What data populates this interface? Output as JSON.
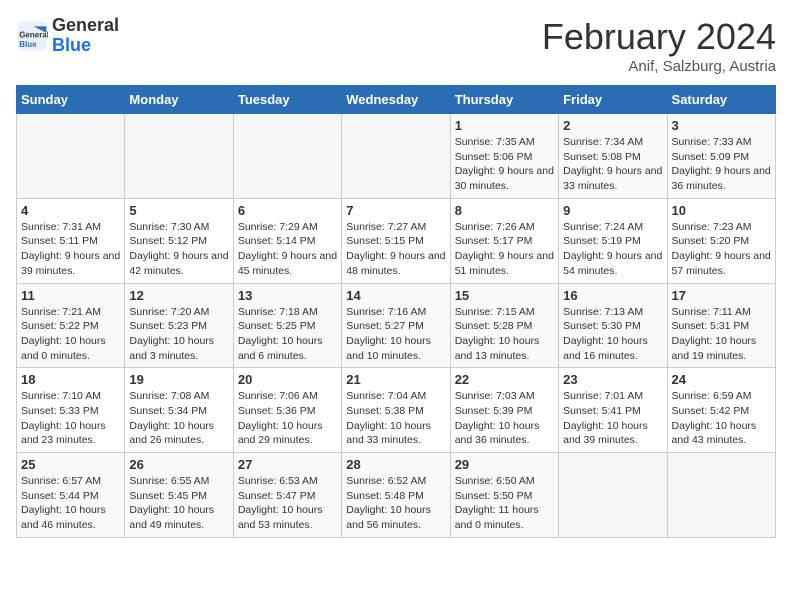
{
  "header": {
    "logo_line1": "General",
    "logo_line2": "Blue",
    "month": "February 2024",
    "location": "Anif, Salzburg, Austria"
  },
  "weekdays": [
    "Sunday",
    "Monday",
    "Tuesday",
    "Wednesday",
    "Thursday",
    "Friday",
    "Saturday"
  ],
  "weeks": [
    [
      null,
      null,
      null,
      null,
      {
        "day": "1",
        "sunrise": "7:35 AM",
        "sunset": "5:06 PM",
        "daylight": "9 hours and 30 minutes."
      },
      {
        "day": "2",
        "sunrise": "7:34 AM",
        "sunset": "5:08 PM",
        "daylight": "9 hours and 33 minutes."
      },
      {
        "day": "3",
        "sunrise": "7:33 AM",
        "sunset": "5:09 PM",
        "daylight": "9 hours and 36 minutes."
      }
    ],
    [
      {
        "day": "4",
        "sunrise": "7:31 AM",
        "sunset": "5:11 PM",
        "daylight": "9 hours and 39 minutes."
      },
      {
        "day": "5",
        "sunrise": "7:30 AM",
        "sunset": "5:12 PM",
        "daylight": "9 hours and 42 minutes."
      },
      {
        "day": "6",
        "sunrise": "7:29 AM",
        "sunset": "5:14 PM",
        "daylight": "9 hours and 45 minutes."
      },
      {
        "day": "7",
        "sunrise": "7:27 AM",
        "sunset": "5:15 PM",
        "daylight": "9 hours and 48 minutes."
      },
      {
        "day": "8",
        "sunrise": "7:26 AM",
        "sunset": "5:17 PM",
        "daylight": "9 hours and 51 minutes."
      },
      {
        "day": "9",
        "sunrise": "7:24 AM",
        "sunset": "5:19 PM",
        "daylight": "9 hours and 54 minutes."
      },
      {
        "day": "10",
        "sunrise": "7:23 AM",
        "sunset": "5:20 PM",
        "daylight": "9 hours and 57 minutes."
      }
    ],
    [
      {
        "day": "11",
        "sunrise": "7:21 AM",
        "sunset": "5:22 PM",
        "daylight": "10 hours and 0 minutes."
      },
      {
        "day": "12",
        "sunrise": "7:20 AM",
        "sunset": "5:23 PM",
        "daylight": "10 hours and 3 minutes."
      },
      {
        "day": "13",
        "sunrise": "7:18 AM",
        "sunset": "5:25 PM",
        "daylight": "10 hours and 6 minutes."
      },
      {
        "day": "14",
        "sunrise": "7:16 AM",
        "sunset": "5:27 PM",
        "daylight": "10 hours and 10 minutes."
      },
      {
        "day": "15",
        "sunrise": "7:15 AM",
        "sunset": "5:28 PM",
        "daylight": "10 hours and 13 minutes."
      },
      {
        "day": "16",
        "sunrise": "7:13 AM",
        "sunset": "5:30 PM",
        "daylight": "10 hours and 16 minutes."
      },
      {
        "day": "17",
        "sunrise": "7:11 AM",
        "sunset": "5:31 PM",
        "daylight": "10 hours and 19 minutes."
      }
    ],
    [
      {
        "day": "18",
        "sunrise": "7:10 AM",
        "sunset": "5:33 PM",
        "daylight": "10 hours and 23 minutes."
      },
      {
        "day": "19",
        "sunrise": "7:08 AM",
        "sunset": "5:34 PM",
        "daylight": "10 hours and 26 minutes."
      },
      {
        "day": "20",
        "sunrise": "7:06 AM",
        "sunset": "5:36 PM",
        "daylight": "10 hours and 29 minutes."
      },
      {
        "day": "21",
        "sunrise": "7:04 AM",
        "sunset": "5:38 PM",
        "daylight": "10 hours and 33 minutes."
      },
      {
        "day": "22",
        "sunrise": "7:03 AM",
        "sunset": "5:39 PM",
        "daylight": "10 hours and 36 minutes."
      },
      {
        "day": "23",
        "sunrise": "7:01 AM",
        "sunset": "5:41 PM",
        "daylight": "10 hours and 39 minutes."
      },
      {
        "day": "24",
        "sunrise": "6:59 AM",
        "sunset": "5:42 PM",
        "daylight": "10 hours and 43 minutes."
      }
    ],
    [
      {
        "day": "25",
        "sunrise": "6:57 AM",
        "sunset": "5:44 PM",
        "daylight": "10 hours and 46 minutes."
      },
      {
        "day": "26",
        "sunrise": "6:55 AM",
        "sunset": "5:45 PM",
        "daylight": "10 hours and 49 minutes."
      },
      {
        "day": "27",
        "sunrise": "6:53 AM",
        "sunset": "5:47 PM",
        "daylight": "10 hours and 53 minutes."
      },
      {
        "day": "28",
        "sunrise": "6:52 AM",
        "sunset": "5:48 PM",
        "daylight": "10 hours and 56 minutes."
      },
      {
        "day": "29",
        "sunrise": "6:50 AM",
        "sunset": "5:50 PM",
        "daylight": "11 hours and 0 minutes."
      },
      null,
      null
    ]
  ]
}
